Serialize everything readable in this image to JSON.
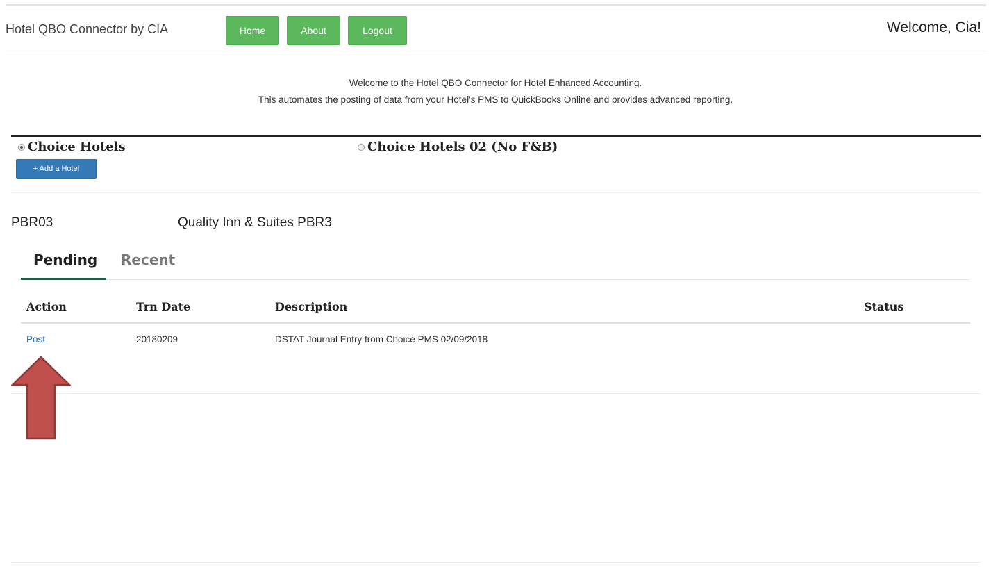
{
  "navbar": {
    "brand": "Hotel QBO Connector by CIA",
    "buttons": [
      "Home",
      "About",
      "Logout"
    ],
    "welcome": "Welcome, Cia!",
    "button_color": "#5cb85c"
  },
  "intro": {
    "line1": "Welcome to the Hotel QBO Connector for Hotel Enhanced Accounting.",
    "line2": "This automates the posting of data from your Hotel's PMS to QuickBooks Online and provides advanced reporting."
  },
  "hotels": {
    "options": [
      {
        "label": "Choice Hotels",
        "selected": true
      },
      {
        "label": "Choice Hotels 02 (No F&B)",
        "selected": false
      }
    ],
    "add_label": "+ Add a Hotel"
  },
  "property": {
    "code": "PBR03",
    "name": "Quality Inn & Suites PBR3"
  },
  "tabs": [
    {
      "label": "Pending",
      "active": true
    },
    {
      "label": "Recent",
      "active": false
    }
  ],
  "table": {
    "headers": [
      "Action",
      "Trn Date",
      "Description",
      "Status"
    ],
    "rows": [
      {
        "action": "Post",
        "date": "20180209",
        "description": "DSTAT Journal Entry from Choice PMS 02/09/2018",
        "status": ""
      }
    ]
  },
  "annotation": {
    "arrow_color": "#c0504d",
    "arrow_icon": "up-arrow-icon"
  }
}
